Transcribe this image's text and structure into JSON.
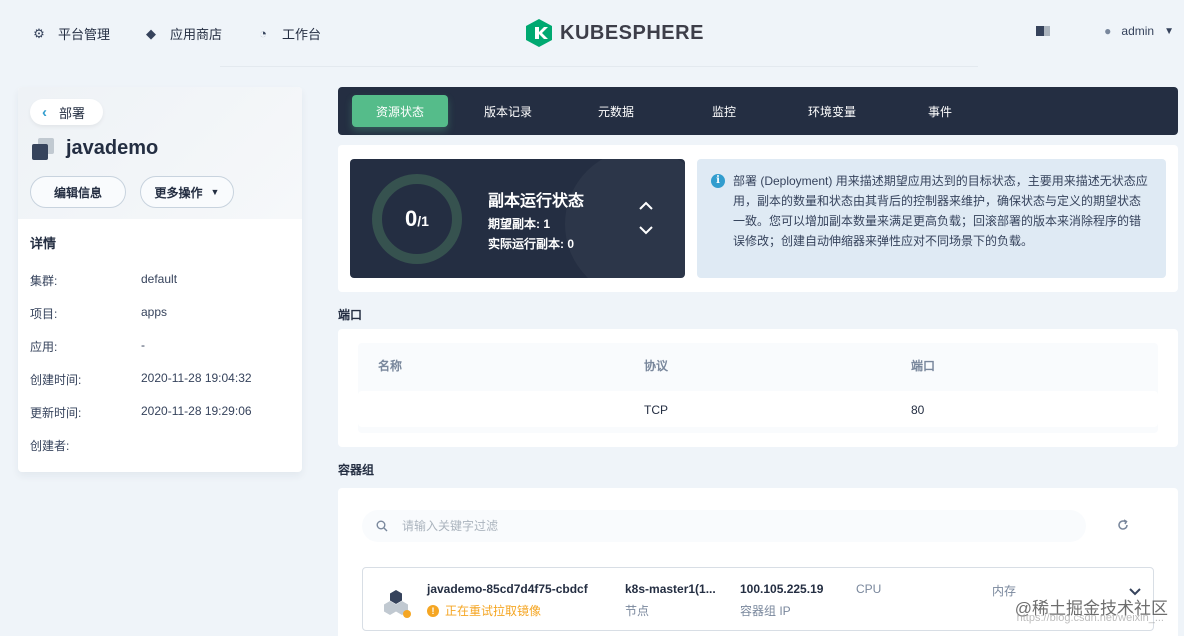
{
  "topnav": {
    "items": [
      {
        "label": "平台管理",
        "icon": "gear-icon"
      },
      {
        "label": "应用商店",
        "icon": "layers-icon"
      },
      {
        "label": "工作台",
        "icon": "dashboard-icon"
      }
    ],
    "logo_text": "KUBESPHERE",
    "user": "admin"
  },
  "left": {
    "back_label": "部署",
    "resource_name": "javademo",
    "edit_button": "编辑信息",
    "more_button": "更多操作",
    "details_title": "详情",
    "details": [
      {
        "key": "集群:",
        "value": "default"
      },
      {
        "key": "项目:",
        "value": "apps"
      },
      {
        "key": "应用:",
        "value": "-"
      },
      {
        "key": "创建时间:",
        "value": "2020-11-28 19:04:32"
      },
      {
        "key": "更新时间:",
        "value": "2020-11-28 19:29:06"
      },
      {
        "key": "创建者:",
        "value": ""
      }
    ]
  },
  "tabs": [
    "资源状态",
    "版本记录",
    "元数据",
    "监控",
    "环境变量",
    "事件"
  ],
  "replica": {
    "current": "0",
    "desired": "/1",
    "title": "副本运行状态",
    "desired_line": "期望副本: 1",
    "actual_line": "实际运行副本: 0",
    "current_fraction": 0
  },
  "info_text": "部署 (Deployment) 用来描述期望应用达到的目标状态，主要用来描述无状态应用，副本的数量和状态由其背后的控制器来维护，确保状态与定义的期望状态一致。您可以增加副本数量来满足更高负载；回滚部署的版本来消除程序的错误修改；创建自动伸缩器来弹性应对不同场景下的负载。",
  "ports": {
    "section_label": "端口",
    "headers": [
      "名称",
      "协议",
      "端口"
    ],
    "rows": [
      {
        "name": "",
        "protocol": "TCP",
        "port": "80"
      }
    ]
  },
  "pods": {
    "section_label": "容器组",
    "search_placeholder": "请输入关键字过滤",
    "items": [
      {
        "name": "javademo-85cd7d4f75-cbdcf",
        "status": "正在重试拉取镜像",
        "node": "k8s-master1(1...",
        "node_label": "节点",
        "pod_ip": "100.105.225.19",
        "pod_ip_label": "容器组 IP",
        "cpu_label": "CPU",
        "memory_label": "内存"
      }
    ]
  },
  "watermark": "@稀土掘金技术社区",
  "watermark2": "https://blog.csdn.net/weixin_..."
}
